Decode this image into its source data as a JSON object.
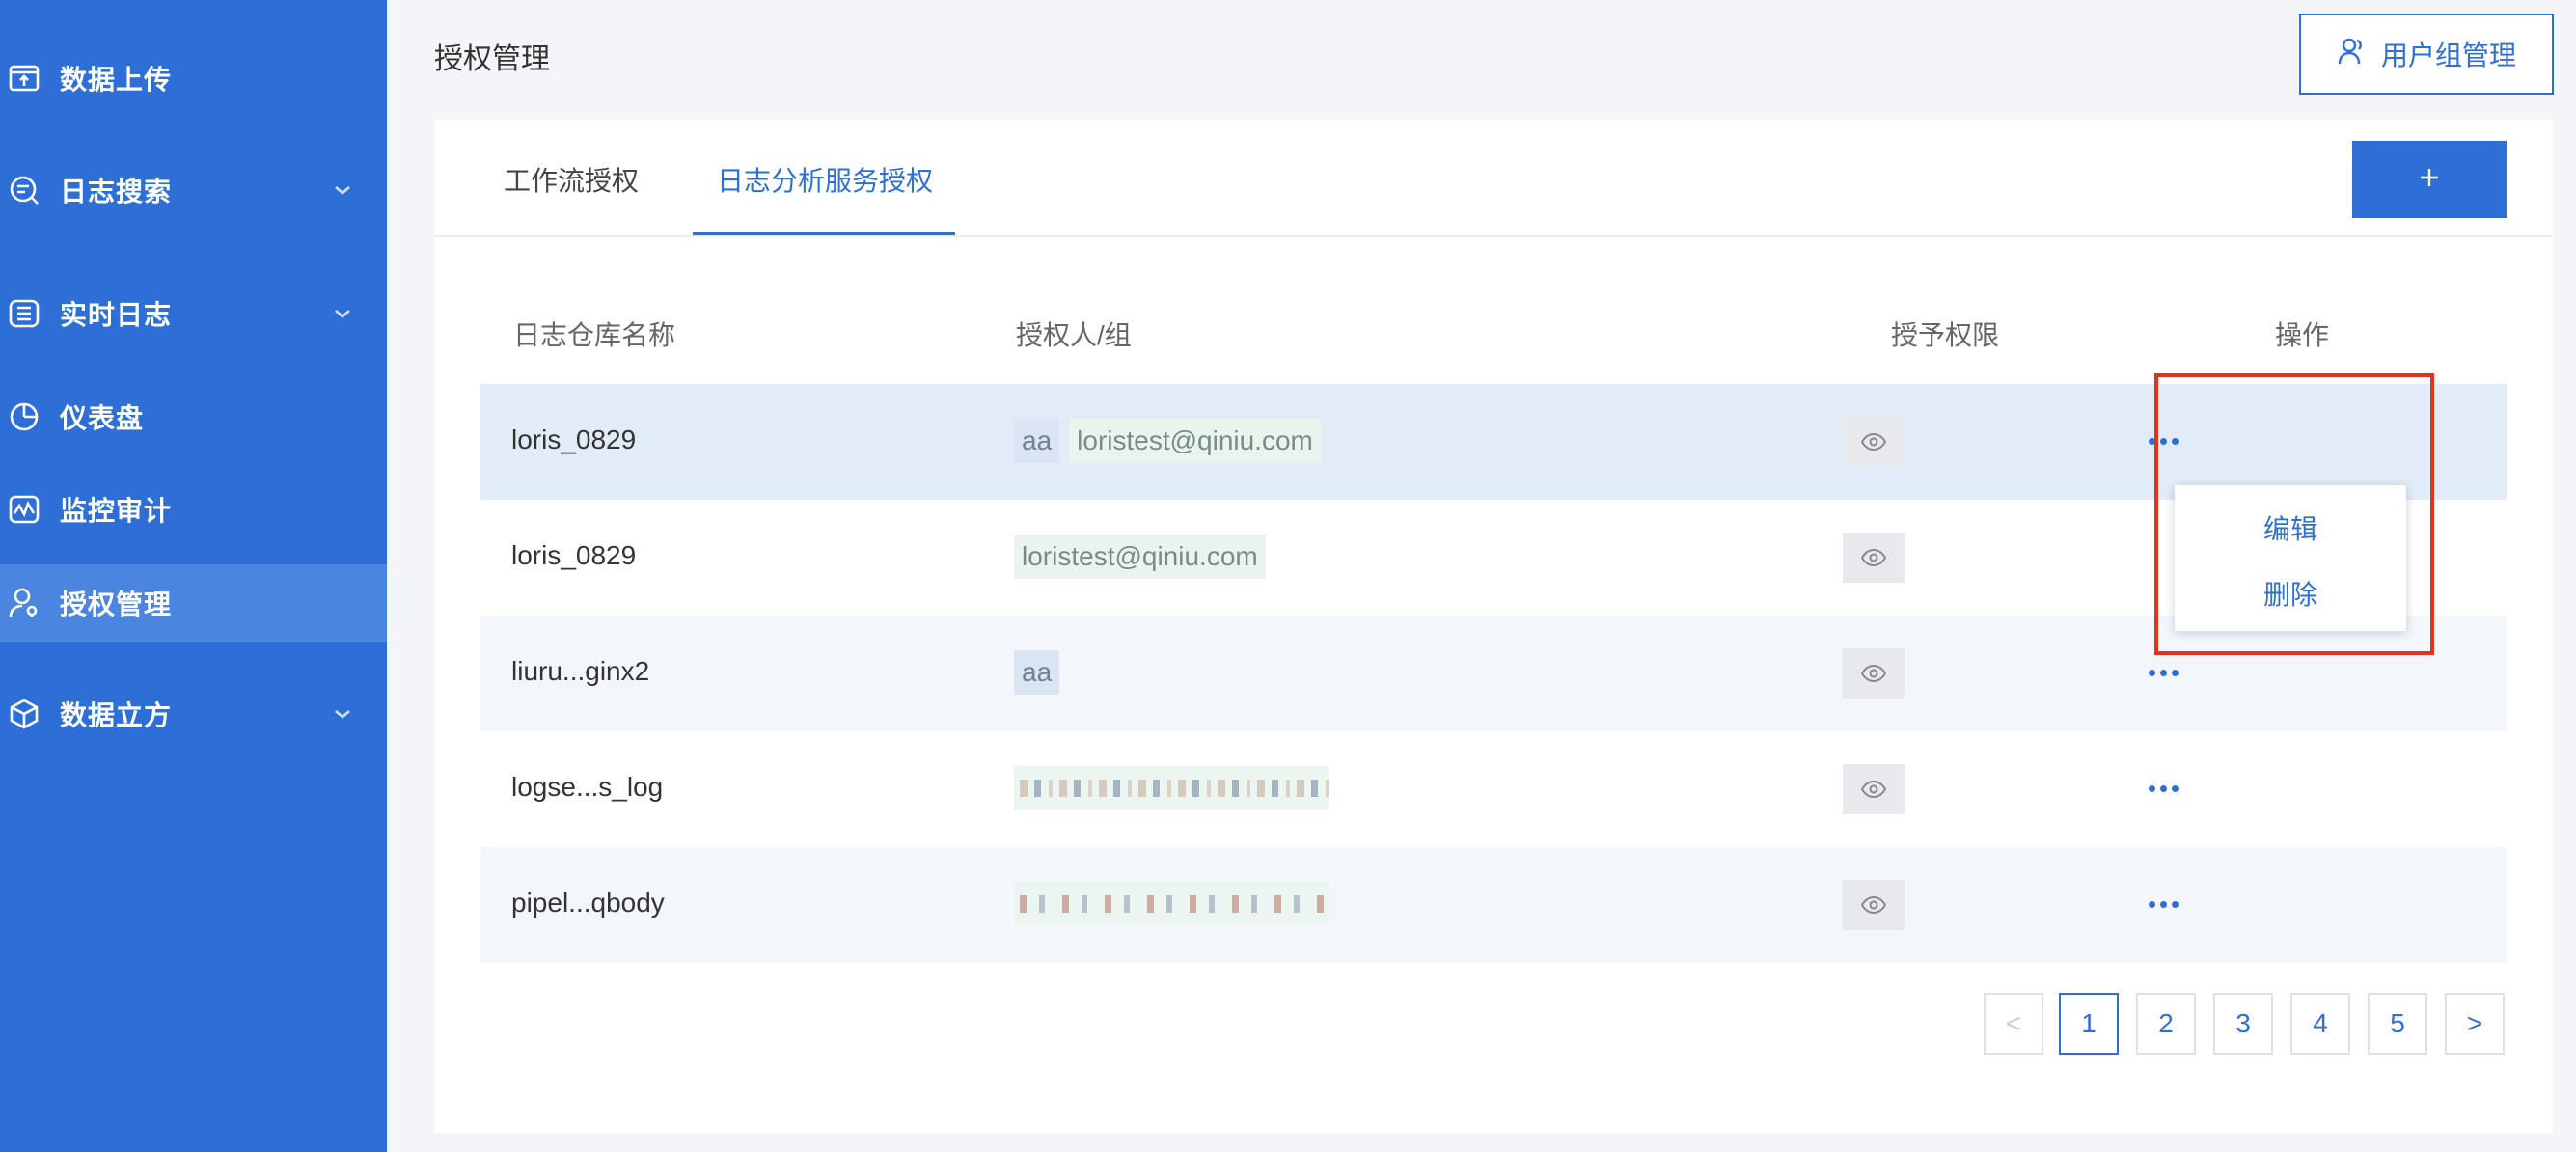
{
  "sidebar": {
    "items": [
      {
        "label": "数据上传",
        "icon": "upload-icon"
      },
      {
        "label": "日志搜索",
        "icon": "log-search-icon",
        "expandable": true
      },
      {
        "label": "实时日志",
        "icon": "realtime-log-icon",
        "expandable": true
      },
      {
        "label": "仪表盘",
        "icon": "dashboard-icon"
      },
      {
        "label": "监控审计",
        "icon": "monitor-icon"
      },
      {
        "label": "授权管理",
        "icon": "authorization-icon",
        "active": true
      },
      {
        "label": "数据立方",
        "icon": "data-cube-icon",
        "expandable": true
      }
    ]
  },
  "header": {
    "title": "授权管理",
    "group_button": "用户组管理"
  },
  "tabs": [
    {
      "label": "工作流授权"
    },
    {
      "label": "日志分析服务授权",
      "active": true
    }
  ],
  "add_button": "+",
  "table": {
    "headers": {
      "repo": "日志仓库名称",
      "grantee": "授权人/组",
      "permission": "授予权限",
      "actions": "操作"
    },
    "rows": [
      {
        "repo": "loris_0829",
        "group": "aa",
        "user": "loristest@qiniu.com",
        "permission_icon": "eye-icon"
      },
      {
        "repo": "loris_0829",
        "group": "",
        "user": "loristest@qiniu.com",
        "permission_icon": "eye-icon"
      },
      {
        "repo": "liuru...ginx2",
        "group": "aa",
        "user": "",
        "permission_icon": "eye-icon"
      },
      {
        "repo": "logse...s_log",
        "group": "",
        "user": "",
        "redacted": true,
        "permission_icon": "eye-icon"
      },
      {
        "repo": "pipel...qbody",
        "group": "",
        "user": "",
        "redacted": true,
        "permission_icon": "eye-icon"
      }
    ]
  },
  "dropdown": {
    "edit": "编辑",
    "delete": "删除"
  },
  "pagination": {
    "prev": "<",
    "pages": [
      "1",
      "2",
      "3",
      "4",
      "5"
    ],
    "current": "1",
    "next": ">"
  },
  "colors": {
    "primary": "#2d6fd6",
    "highlight_box": "#e8311a"
  }
}
